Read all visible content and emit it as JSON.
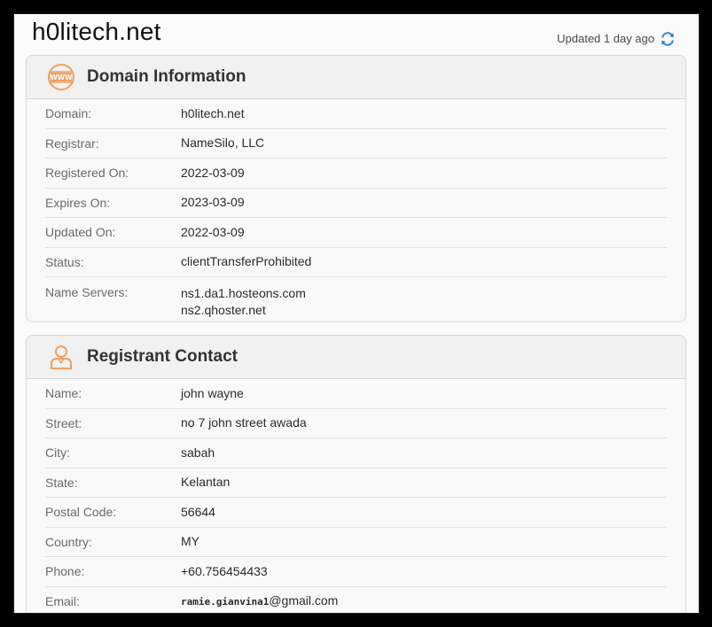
{
  "header": {
    "site_title": "h0litech.net",
    "updated_text": "Updated 1 day ago"
  },
  "icons": {
    "refresh": "refresh-icon",
    "www": "www-globe-icon",
    "person": "person-icon"
  },
  "colors": {
    "accent_orange": "#f0a060",
    "refresh_blue": "#2f7fd6"
  },
  "domain_info": {
    "title": "Domain Information",
    "rows": [
      {
        "label": "Domain:",
        "value": "h0litech.net"
      },
      {
        "label": "Registrar:",
        "value": "NameSilo, LLC"
      },
      {
        "label": "Registered On:",
        "value": "2022-03-09"
      },
      {
        "label": "Expires On:",
        "value": "2023-03-09"
      },
      {
        "label": "Updated On:",
        "value": "2022-03-09"
      },
      {
        "label": "Status:",
        "value": "clientTransferProhibited"
      }
    ],
    "name_servers_label": "Name Servers:",
    "name_servers": [
      "ns1.da1.hosteons.com",
      "ns2.qhoster.net"
    ]
  },
  "registrant": {
    "title": "Registrant Contact",
    "rows": [
      {
        "label": "Name:",
        "value": "john wayne"
      },
      {
        "label": "Street:",
        "value": "no 7 john street awada"
      },
      {
        "label": "City:",
        "value": "sabah"
      },
      {
        "label": "State:",
        "value": "Kelantan"
      },
      {
        "label": "Postal Code:",
        "value": "56644"
      },
      {
        "label": "Country:",
        "value": "MY"
      },
      {
        "label": "Phone:",
        "value": "+60.756454433"
      }
    ],
    "email_label": "Email:",
    "email_user": "ramie.gianvina1",
    "email_domain": "@gmail.com"
  }
}
